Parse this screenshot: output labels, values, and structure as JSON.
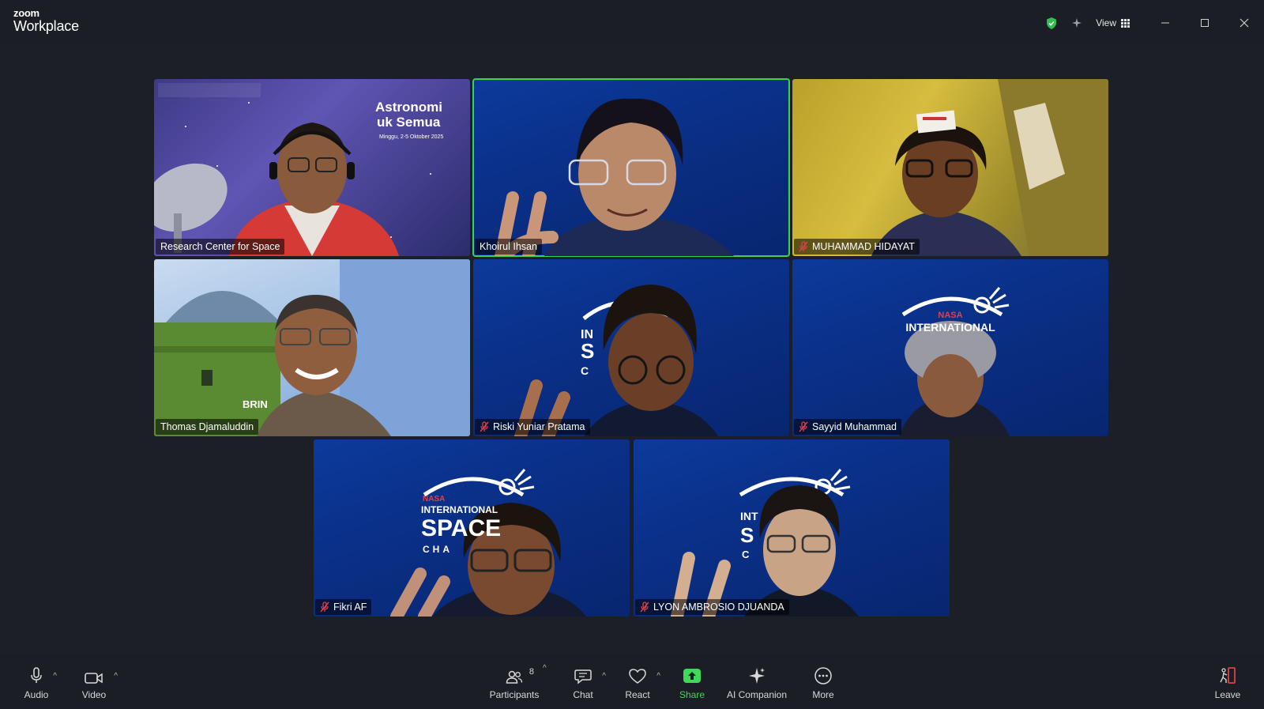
{
  "app": {
    "brand_top": "zoom",
    "brand_bottom": "Workplace",
    "view_label": "View"
  },
  "participants": [
    {
      "name": "Research Center for Space",
      "muted": false,
      "active": false
    },
    {
      "name": "Khoirul Ihsan",
      "muted": false,
      "active": true
    },
    {
      "name": "MUHAMMAD HIDAYAT",
      "muted": true,
      "active": false
    },
    {
      "name": "Thomas Djamaluddin",
      "muted": false,
      "active": false
    },
    {
      "name": "Riski Yuniar Pratama",
      "muted": true,
      "active": false
    },
    {
      "name": "Sayyid Muhammad",
      "muted": true,
      "active": false
    },
    {
      "name": "Fikri AF",
      "muted": true,
      "active": false
    },
    {
      "name": "LYON AMBROSIO DJUANDA",
      "muted": true,
      "active": false
    }
  ],
  "backgrounds": {
    "astro_title_1": "Astronomi",
    "astro_title_2": "uk Semua",
    "astro_date": "Minggu, 2-5 Oktober 2025",
    "nasa_top": "NASA",
    "nasa_line": "INTERNATIONAL",
    "nasa_space": "SPACE",
    "nasa_cha": "CHA",
    "brin": "BRIN"
  },
  "toolbar": {
    "audio": "Audio",
    "video": "Video",
    "participants": "Participants",
    "participants_count": "8",
    "chat": "Chat",
    "react": "React",
    "share": "Share",
    "ai_companion": "AI Companion",
    "more": "More",
    "leave": "Leave"
  },
  "colors": {
    "active_speaker": "#39d353",
    "share_green": "#3fd85a",
    "mute_red": "#e0404a"
  }
}
